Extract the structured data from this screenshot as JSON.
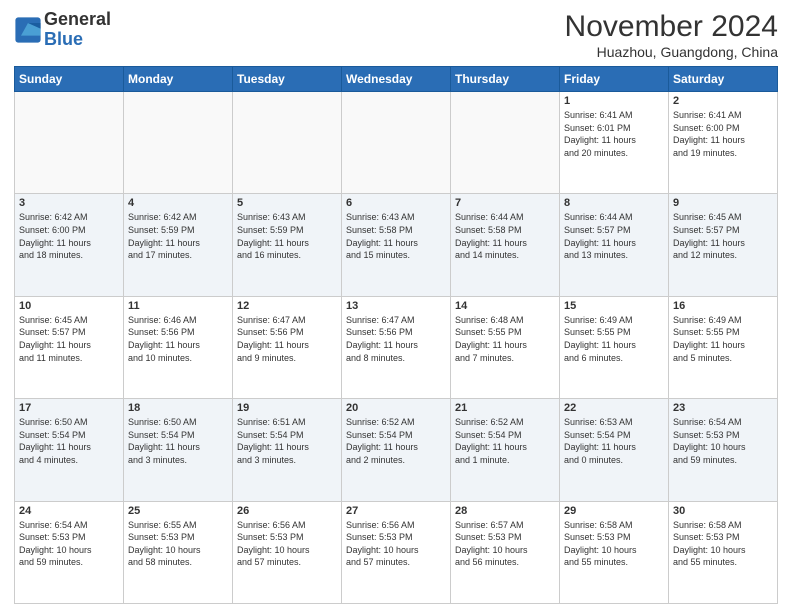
{
  "header": {
    "logo_general": "General",
    "logo_blue": "Blue",
    "month_title": "November 2024",
    "location": "Huazhou, Guangdong, China"
  },
  "days_of_week": [
    "Sunday",
    "Monday",
    "Tuesday",
    "Wednesday",
    "Thursday",
    "Friday",
    "Saturday"
  ],
  "weeks": [
    [
      {
        "day": "",
        "info": ""
      },
      {
        "day": "",
        "info": ""
      },
      {
        "day": "",
        "info": ""
      },
      {
        "day": "",
        "info": ""
      },
      {
        "day": "",
        "info": ""
      },
      {
        "day": "1",
        "info": "Sunrise: 6:41 AM\nSunset: 6:01 PM\nDaylight: 11 hours\nand 20 minutes."
      },
      {
        "day": "2",
        "info": "Sunrise: 6:41 AM\nSunset: 6:00 PM\nDaylight: 11 hours\nand 19 minutes."
      }
    ],
    [
      {
        "day": "3",
        "info": "Sunrise: 6:42 AM\nSunset: 6:00 PM\nDaylight: 11 hours\nand 18 minutes."
      },
      {
        "day": "4",
        "info": "Sunrise: 6:42 AM\nSunset: 5:59 PM\nDaylight: 11 hours\nand 17 minutes."
      },
      {
        "day": "5",
        "info": "Sunrise: 6:43 AM\nSunset: 5:59 PM\nDaylight: 11 hours\nand 16 minutes."
      },
      {
        "day": "6",
        "info": "Sunrise: 6:43 AM\nSunset: 5:58 PM\nDaylight: 11 hours\nand 15 minutes."
      },
      {
        "day": "7",
        "info": "Sunrise: 6:44 AM\nSunset: 5:58 PM\nDaylight: 11 hours\nand 14 minutes."
      },
      {
        "day": "8",
        "info": "Sunrise: 6:44 AM\nSunset: 5:57 PM\nDaylight: 11 hours\nand 13 minutes."
      },
      {
        "day": "9",
        "info": "Sunrise: 6:45 AM\nSunset: 5:57 PM\nDaylight: 11 hours\nand 12 minutes."
      }
    ],
    [
      {
        "day": "10",
        "info": "Sunrise: 6:45 AM\nSunset: 5:57 PM\nDaylight: 11 hours\nand 11 minutes."
      },
      {
        "day": "11",
        "info": "Sunrise: 6:46 AM\nSunset: 5:56 PM\nDaylight: 11 hours\nand 10 minutes."
      },
      {
        "day": "12",
        "info": "Sunrise: 6:47 AM\nSunset: 5:56 PM\nDaylight: 11 hours\nand 9 minutes."
      },
      {
        "day": "13",
        "info": "Sunrise: 6:47 AM\nSunset: 5:56 PM\nDaylight: 11 hours\nand 8 minutes."
      },
      {
        "day": "14",
        "info": "Sunrise: 6:48 AM\nSunset: 5:55 PM\nDaylight: 11 hours\nand 7 minutes."
      },
      {
        "day": "15",
        "info": "Sunrise: 6:49 AM\nSunset: 5:55 PM\nDaylight: 11 hours\nand 6 minutes."
      },
      {
        "day": "16",
        "info": "Sunrise: 6:49 AM\nSunset: 5:55 PM\nDaylight: 11 hours\nand 5 minutes."
      }
    ],
    [
      {
        "day": "17",
        "info": "Sunrise: 6:50 AM\nSunset: 5:54 PM\nDaylight: 11 hours\nand 4 minutes."
      },
      {
        "day": "18",
        "info": "Sunrise: 6:50 AM\nSunset: 5:54 PM\nDaylight: 11 hours\nand 3 minutes."
      },
      {
        "day": "19",
        "info": "Sunrise: 6:51 AM\nSunset: 5:54 PM\nDaylight: 11 hours\nand 3 minutes."
      },
      {
        "day": "20",
        "info": "Sunrise: 6:52 AM\nSunset: 5:54 PM\nDaylight: 11 hours\nand 2 minutes."
      },
      {
        "day": "21",
        "info": "Sunrise: 6:52 AM\nSunset: 5:54 PM\nDaylight: 11 hours\nand 1 minute."
      },
      {
        "day": "22",
        "info": "Sunrise: 6:53 AM\nSunset: 5:54 PM\nDaylight: 11 hours\nand 0 minutes."
      },
      {
        "day": "23",
        "info": "Sunrise: 6:54 AM\nSunset: 5:53 PM\nDaylight: 10 hours\nand 59 minutes."
      }
    ],
    [
      {
        "day": "24",
        "info": "Sunrise: 6:54 AM\nSunset: 5:53 PM\nDaylight: 10 hours\nand 59 minutes."
      },
      {
        "day": "25",
        "info": "Sunrise: 6:55 AM\nSunset: 5:53 PM\nDaylight: 10 hours\nand 58 minutes."
      },
      {
        "day": "26",
        "info": "Sunrise: 6:56 AM\nSunset: 5:53 PM\nDaylight: 10 hours\nand 57 minutes."
      },
      {
        "day": "27",
        "info": "Sunrise: 6:56 AM\nSunset: 5:53 PM\nDaylight: 10 hours\nand 57 minutes."
      },
      {
        "day": "28",
        "info": "Sunrise: 6:57 AM\nSunset: 5:53 PM\nDaylight: 10 hours\nand 56 minutes."
      },
      {
        "day": "29",
        "info": "Sunrise: 6:58 AM\nSunset: 5:53 PM\nDaylight: 10 hours\nand 55 minutes."
      },
      {
        "day": "30",
        "info": "Sunrise: 6:58 AM\nSunset: 5:53 PM\nDaylight: 10 hours\nand 55 minutes."
      }
    ]
  ]
}
